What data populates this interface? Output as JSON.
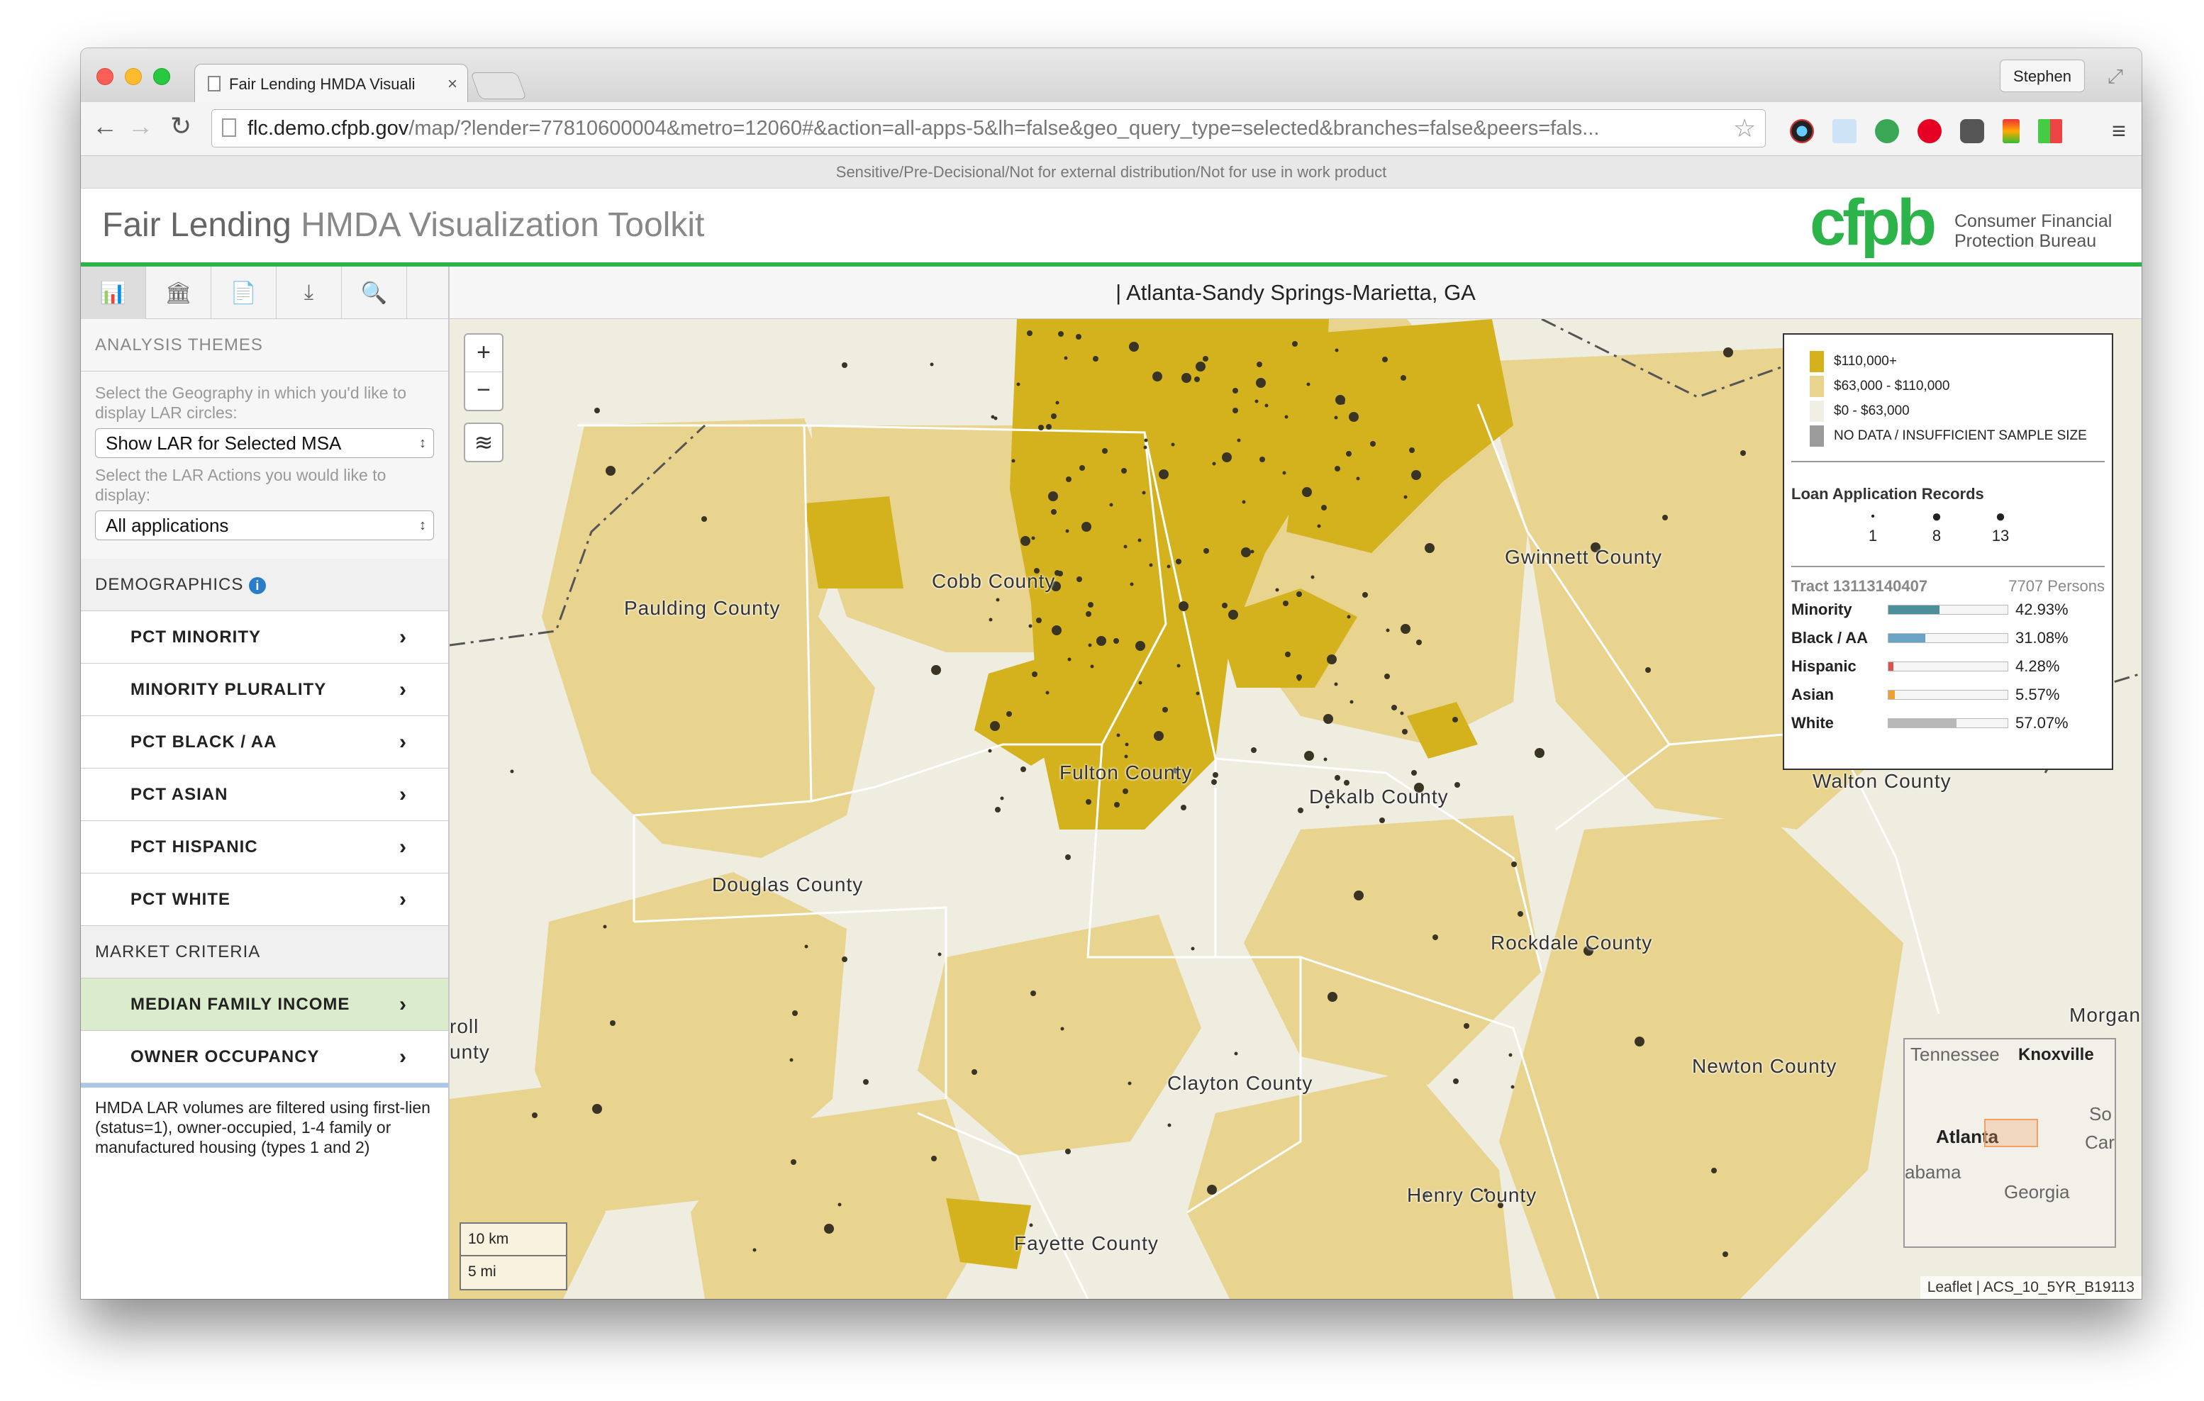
{
  "browser": {
    "tab_title": "Fair Lending HMDA Visuali",
    "user": "Stephen",
    "url_host": "flc.demo.cfpb.gov",
    "url_rest": "/map/?lender=77810600004&metro=12060#&action=all-apps-5&lh=false&geo_query_type=selected&branches=false&peers=fals..."
  },
  "banner": "Sensitive/Pre-Decisional/Not for external distribution/Not for use in work product",
  "header": {
    "title_bold": "Fair Lending",
    "title_rest": "HMDA Visualization Toolkit",
    "logo_mark": "cfpb",
    "logo_line1": "Consumer Financial",
    "logo_line2": "Protection Bureau",
    "brand_color": "#2cb34a"
  },
  "sidebar": {
    "tool_icons": [
      "bar-chart-icon",
      "bank-icon",
      "document-icon",
      "download-icon",
      "search-icon"
    ],
    "analysis_heading": "ANALYSIS THEMES",
    "geo_label": "Select the Geography in which you'd like to display LAR circles:",
    "geo_value": "Show LAR for Selected MSA",
    "actions_label": "Select the LAR Actions you would like to display:",
    "actions_value": "All applications",
    "demographics_heading": "DEMOGRAPHICS",
    "demographics": [
      "PCT MINORITY",
      "MINORITY PLURALITY",
      "PCT BLACK / AA",
      "PCT ASIAN",
      "PCT HISPANIC",
      "PCT WHITE"
    ],
    "market_heading": "MARKET CRITERIA",
    "market": [
      "MEDIAN FAMILY INCOME",
      "OWNER OCCUPANCY"
    ],
    "active_item": "MEDIAN FAMILY INCOME",
    "note": "HMDA LAR volumes are filtered using first-lien (status=1), owner-occupied, 1-4 family or manufactured housing (types 1 and 2)"
  },
  "main": {
    "metro_title": "| Atlanta-Sandy Springs-Marietta, GA"
  },
  "map": {
    "zoom_in": "+",
    "zoom_out": "−",
    "scale_km": "10 km",
    "scale_mi": "5 mi",
    "attribution": "Leaflet | ACS_10_5YR_B19113",
    "counties": [
      "Paulding County",
      "Cobb County",
      "Gwinnett County",
      "Fulton County",
      "Dekalb County",
      "Walton County",
      "Douglas County",
      "Rockdale County",
      "Clayton County",
      "Newton County",
      "Henry County",
      "Fayette County",
      "roll",
      "unty",
      "Morgan"
    ],
    "legend": {
      "income": [
        {
          "label": "$110,000+",
          "color": "#d4b21e"
        },
        {
          "label": "$63,000 - $110,000",
          "color": "#e8d48f"
        },
        {
          "label": "$0 - $63,000",
          "color": "#f1efe4"
        },
        {
          "label": "NO DATA / INSUFFICIENT SAMPLE SIZE",
          "color": "#9b9b9b"
        }
      ],
      "records_title": "Loan Application Records",
      "records": [
        "1",
        "8",
        "13"
      ],
      "tract": "Tract 13113140407",
      "persons": "7707 Persons",
      "rows": [
        {
          "name": "Minority",
          "value": "42.93%",
          "pct": 42.93,
          "color": "#4b8f9b"
        },
        {
          "name": "Black / AA",
          "value": "31.08%",
          "pct": 31.08,
          "color": "#6aa3c6"
        },
        {
          "name": "Hispanic",
          "value": "4.28%",
          "pct": 4.28,
          "color": "#d9534f"
        },
        {
          "name": "Asian",
          "value": "5.57%",
          "pct": 5.57,
          "color": "#f0a030"
        },
        {
          "name": "White",
          "value": "57.07%",
          "pct": 57.07,
          "color": "#b8b8b8"
        }
      ]
    },
    "inset": {
      "tennessee": "Tennessee",
      "knoxville": "Knoxville",
      "atlanta": "Atlanta",
      "alabama": "abama",
      "georgia": "Georgia",
      "so": "So",
      "car": "Car"
    }
  }
}
